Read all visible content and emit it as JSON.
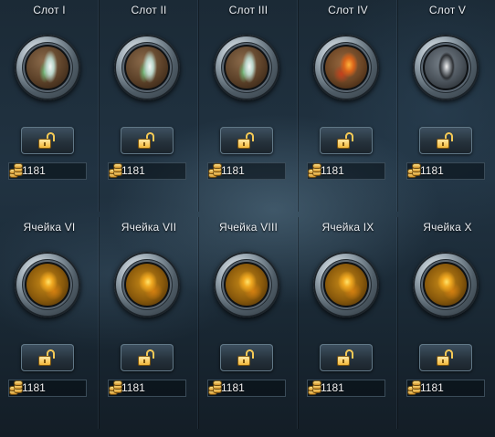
{
  "rows": [
    {
      "slots": [
        {
          "title": "Слот I",
          "orb": "feather-gem-icon",
          "price": "1181"
        },
        {
          "title": "Слот II",
          "orb": "feather-gem-icon",
          "price": "1181"
        },
        {
          "title": "Слот III",
          "orb": "feather-gem-icon",
          "price": "1181"
        },
        {
          "title": "Слот IV",
          "orb": "fire-gem-icon",
          "price": "1181"
        },
        {
          "title": "Слот V",
          "orb": "dark-feather-gem-icon",
          "price": "1181"
        }
      ]
    },
    {
      "slots": [
        {
          "title": "Ячейка VI",
          "orb": "gold-gem-icon",
          "price": "1181"
        },
        {
          "title": "Ячейка VII",
          "orb": "gold-gem-icon",
          "price": "1181"
        },
        {
          "title": "Ячейка VIII",
          "orb": "gold-gem-icon",
          "price": "1181"
        },
        {
          "title": "Ячейка IX",
          "orb": "gold-gem-icon",
          "price": "1181"
        },
        {
          "title": "Ячейка X",
          "orb": "gold-gem-icon",
          "price": "1181"
        }
      ]
    }
  ],
  "icons": {
    "unlock": "unlock-icon",
    "currency": "gold-coins-icon"
  }
}
